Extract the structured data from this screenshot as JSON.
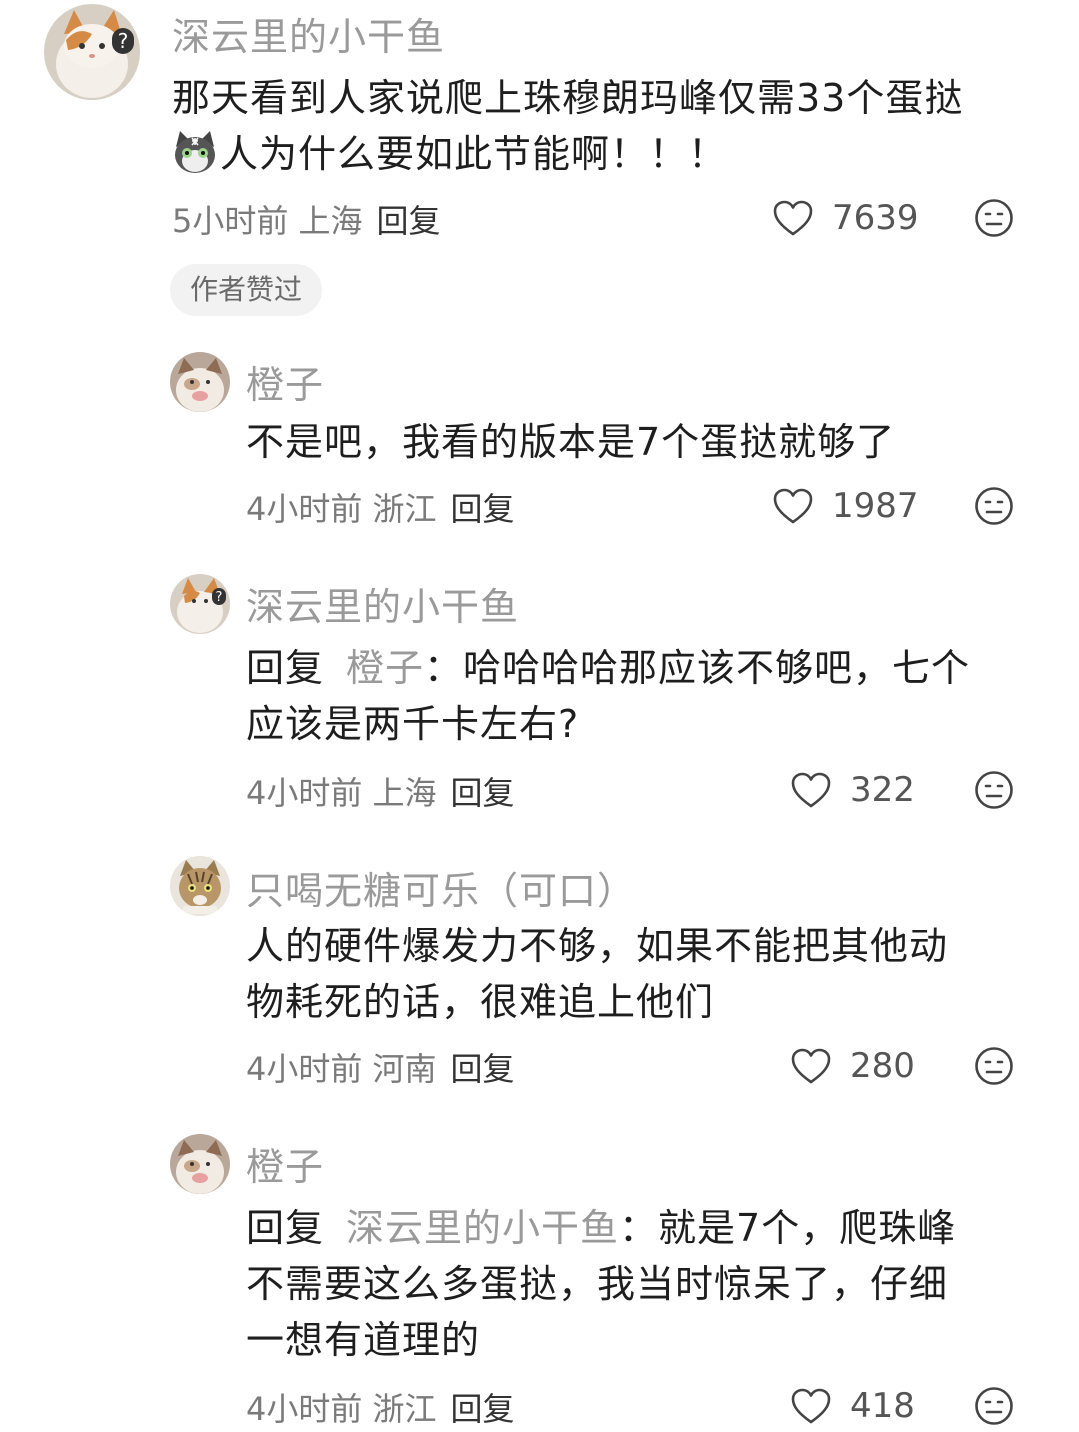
{
  "comments": [
    {
      "author": "深云里的小干鱼",
      "line1": "那天看到人家说爬上珠穆朗玛峰仅需33个蛋挞",
      "line2": "人为什么要如此节能啊！！！",
      "time_location": "5小时前 上海",
      "reply_label": "回复",
      "likes": "7639",
      "badge": "作者赞过"
    },
    {
      "author": "橙子",
      "line1": "不是吧，我看的版本是7个蛋挞就够了",
      "time_location": "4小时前 浙江",
      "reply_label": "回复",
      "likes": "1987"
    },
    {
      "author": "深云里的小干鱼",
      "reply_word": "回复",
      "reply_target": "橙子",
      "line1": "：哈哈哈哈那应该不够吧，七个",
      "line2": "应该是两千卡左右?",
      "time_location": "4小时前 上海",
      "reply_label": "回复",
      "likes": "322"
    },
    {
      "author": "只喝无糖可乐（可口）",
      "line1": "人的硬件爆发力不够，如果不能把其他动",
      "line2": "物耗死的话，很难追上他们",
      "time_location": "4小时前 河南",
      "reply_label": "回复",
      "likes": "280"
    },
    {
      "author": "橙子",
      "reply_word": "回复",
      "reply_target": "深云里的小干鱼",
      "line1": "：就是7个，爬珠峰",
      "line2": "不需要这么多蛋挞，我当时惊呆了，仔细",
      "line3": "一想有道理的",
      "time_location": "4小时前 浙江",
      "reply_label": "回复",
      "likes": "418"
    }
  ],
  "icons": {
    "like": "heart-outline-icon",
    "dislike": "meh-face-icon",
    "emoji": "cat-face-emoji"
  }
}
